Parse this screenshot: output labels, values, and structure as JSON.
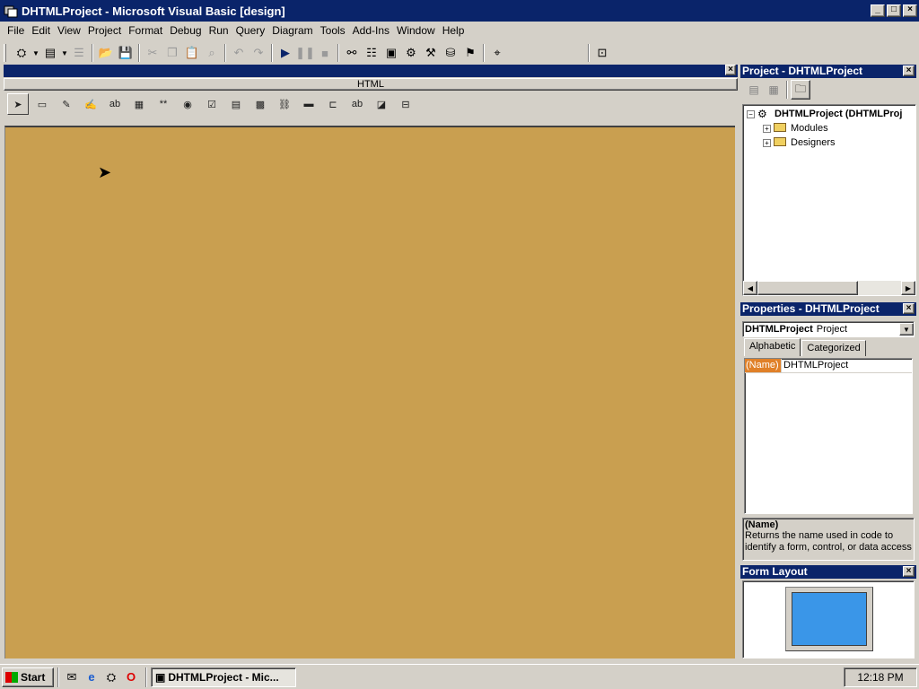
{
  "window": {
    "title": "DHTMLProject - Microsoft Visual Basic [design]",
    "minimize": "_",
    "maximize": "□",
    "close": "×"
  },
  "menu": [
    "File",
    "Edit",
    "View",
    "Project",
    "Format",
    "Debug",
    "Run",
    "Query",
    "Diagram",
    "Tools",
    "Add-Ins",
    "Window",
    "Help"
  ],
  "designer": {
    "close": "×",
    "tab_label": "HTML"
  },
  "project_panel": {
    "title": "Project - DHTMLProject",
    "close": "×",
    "tree": {
      "root": "DHTMLProject (DHTMLProj",
      "children": [
        "Modules",
        "Designers"
      ]
    },
    "expand_minus": "−",
    "expand_plus": "+"
  },
  "properties_panel": {
    "title": "Properties - DHTMLProject",
    "close": "×",
    "object_name": "DHTMLProject",
    "object_type": "Project",
    "tabs": [
      "Alphabetic",
      "Categorized"
    ],
    "rows": [
      {
        "name": "(Name)",
        "value": "DHTMLProject"
      }
    ],
    "description": {
      "name": "(Name)",
      "text": "Returns the name used in code to identify a form, control, or data access"
    }
  },
  "form_layout_panel": {
    "title": "Form Layout",
    "close": "×"
  },
  "taskbar": {
    "start_label": "Start",
    "task_item": "DHTMLProject - Mic...",
    "clock": "12:18 PM"
  },
  "colors": {
    "title_bar": "#0a246a",
    "canvas": "#c99f50",
    "selected_property": "#e08028",
    "monitor_screen": "#3a96e8"
  }
}
